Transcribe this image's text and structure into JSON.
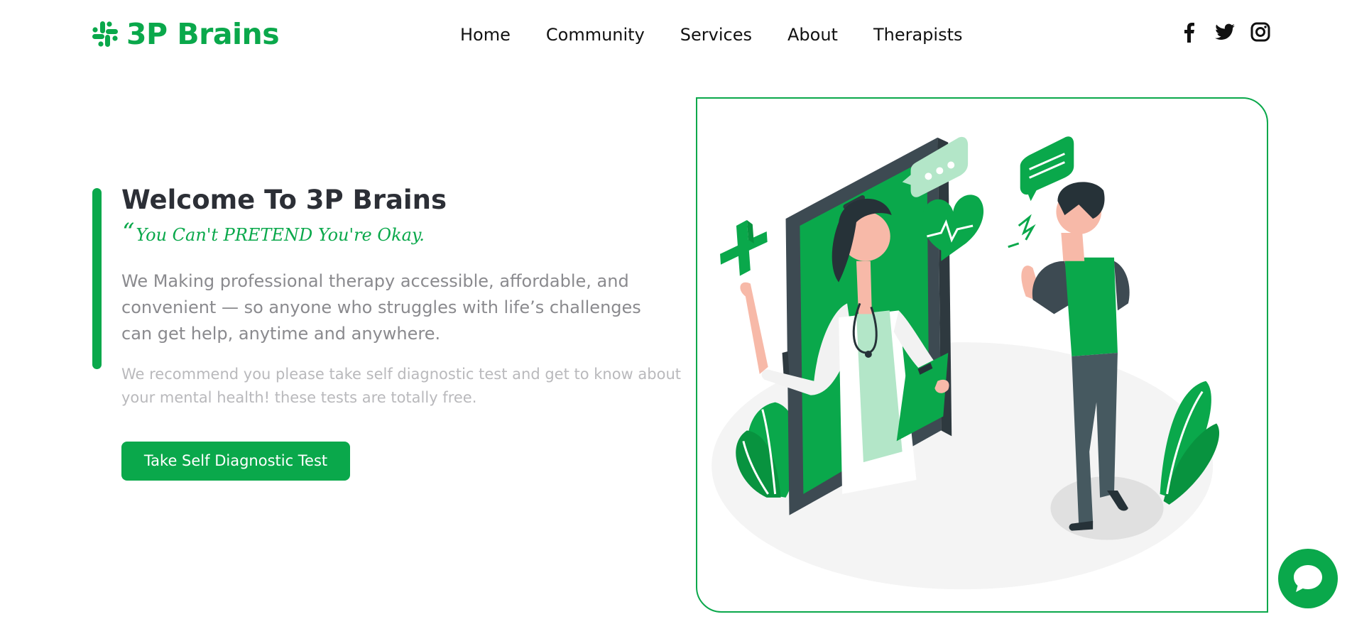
{
  "brand": {
    "name": "3P Brains",
    "logo_icon": "slack-like-grid-icon",
    "color": "#0aa84b"
  },
  "nav": {
    "items": [
      {
        "label": "Home"
      },
      {
        "label": "Community"
      },
      {
        "label": "Services"
      },
      {
        "label": "About"
      },
      {
        "label": "Therapists"
      }
    ]
  },
  "socials": [
    {
      "icon": "facebook-icon"
    },
    {
      "icon": "twitter-icon"
    },
    {
      "icon": "instagram-icon"
    }
  ],
  "hero": {
    "title": "Welcome To 3P Brains",
    "quote_mark": "“",
    "quote": "You Can't PRETEND You're Okay.",
    "description": "We Making professional therapy accessible, affordable, and convenient — so anyone who struggles with life’s challenges can get help, anytime and anywhere.",
    "note": "We recommend you please take self diagnostic test and get to know about your mental health! these tests are totally free.",
    "cta_label": "Take Self Diagnostic Test"
  },
  "illustration": {
    "subject": "doctor-in-phone-illustration"
  },
  "chat": {
    "icon": "chat-bubble-icon"
  },
  "colors": {
    "accent": "#0aa84b",
    "heading": "#2c2f36",
    "body": "#8a8a8e",
    "muted": "#b9b9bc"
  }
}
